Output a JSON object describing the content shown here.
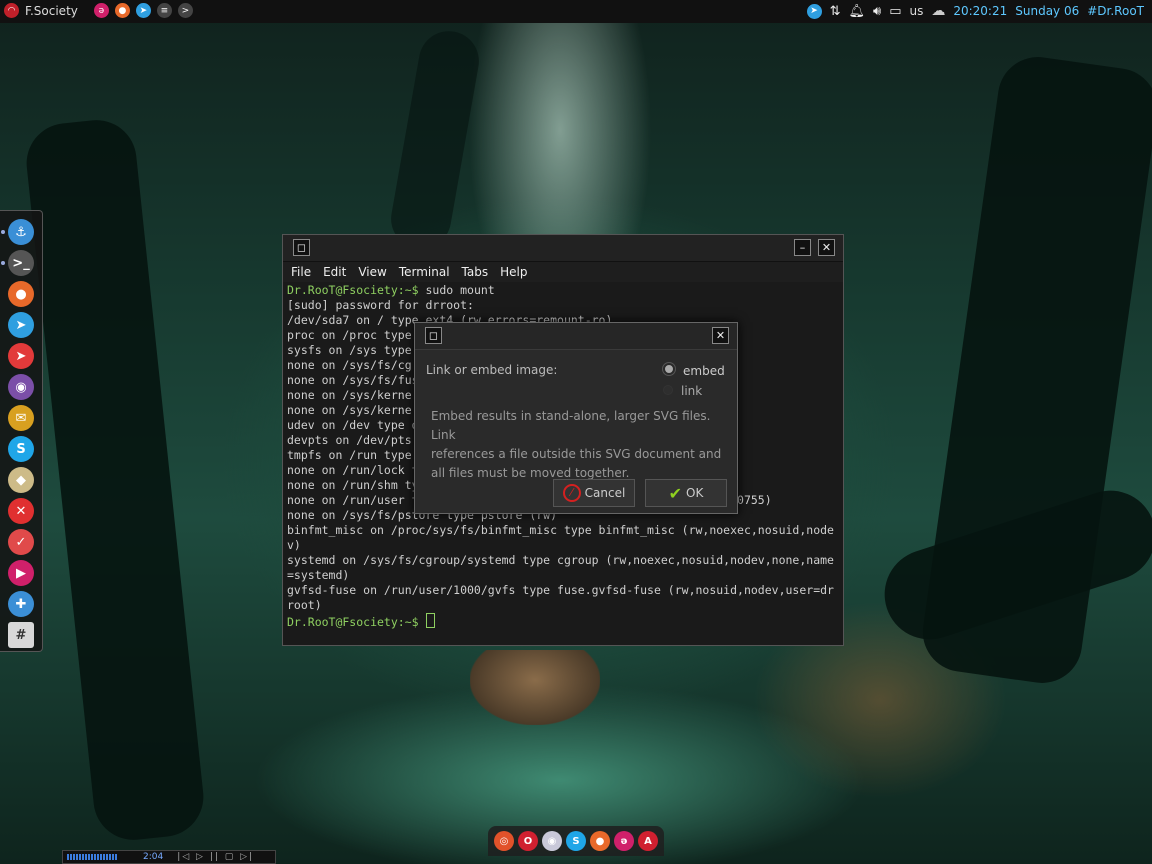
{
  "top_panel": {
    "brand": "F.Society",
    "left_icons": [
      "raspberry-icon",
      "firefox-icon",
      "telegram-icon",
      "menu-icon",
      "terminal-icon"
    ],
    "right_icons": [
      "telegram-icon",
      "network-icon",
      "notification-bell-icon",
      "volume-icon",
      "book-icon"
    ],
    "keyboard_layout": "us",
    "time": "20:20:21",
    "date": "Sunday 06",
    "user": "#Dr.RooT"
  },
  "left_dock": {
    "items": [
      {
        "name": "anchor-icon",
        "glyph": "⚓",
        "color": "#3a8fd6"
      },
      {
        "name": "terminal-icon",
        "glyph": ">_",
        "color": "#555555"
      },
      {
        "name": "firefox-icon",
        "glyph": "●",
        "color": "#e8692a"
      },
      {
        "name": "telegram-icon",
        "glyph": "➤",
        "color": "#2f9fe0"
      },
      {
        "name": "telegram-desktop-icon",
        "glyph": "➤",
        "color": "#e23a3a"
      },
      {
        "name": "chat-bird-icon",
        "glyph": "◉",
        "color": "#7b4fa8"
      },
      {
        "name": "mail-icon",
        "glyph": "✉",
        "color": "#d8a020"
      },
      {
        "name": "skype-icon",
        "glyph": "S",
        "color": "#1fa6e8"
      },
      {
        "name": "inkscape-icon",
        "glyph": "◆",
        "color": "#cdbb88"
      },
      {
        "name": "close-app-icon",
        "glyph": "✕",
        "color": "#e03030"
      },
      {
        "name": "tasks-icon",
        "glyph": "✓",
        "color": "#e04a4a"
      },
      {
        "name": "media-player-icon",
        "glyph": "▶",
        "color": "#d0206a"
      },
      {
        "name": "software-center-icon",
        "glyph": "✚",
        "color": "#3b8fd6"
      },
      {
        "name": "text-editor-icon",
        "glyph": "#",
        "color": "#d8d8d8"
      }
    ]
  },
  "terminal": {
    "menu": [
      "File",
      "Edit",
      "View",
      "Terminal",
      "Tabs",
      "Help"
    ],
    "prompt": "Dr.RooT@Fsociety:~$",
    "command": "sudo mount",
    "lines": [
      "[sudo] password for drroot:",
      "/dev/sda7 on / type ext4 (rw,errors=remount-ro)",
      "proc on /proc type",
      "sysfs on /sys type",
      "none on /sys/fs/cg",
      "none on /sys/fs/fus",
      "none on /sys/kerne",
      "none on /sys/kerne",
      "udev on /dev type d",
      "devpts on /dev/pts",
      "tmpfs on /run type",
      "none on /run/lock t",
      "none on /run/shm ty",
      "none on /run/user t                                     500,mode=0755)",
      "none on /sys/fs/pstore type pstore (rw)",
      "binfmt_misc on /proc/sys/fs/binfmt_misc type binfmt_misc (rw,noexec,nosuid,node",
      "v)",
      "systemd on /sys/fs/cgroup/systemd type cgroup (rw,noexec,nosuid,nodev,none,name",
      "=systemd)",
      "gvfsd-fuse on /run/user/1000/gvfs type fuse.gvfsd-fuse (rw,nosuid,nodev,user=dr",
      "root)"
    ]
  },
  "dialog": {
    "question": "Link or embed image:",
    "options": [
      {
        "label": "embed",
        "selected": true
      },
      {
        "label": "link",
        "selected": false
      }
    ],
    "description": [
      "Embed results in stand-alone, larger SVG files. Link",
      "references a file outside this SVG document and",
      "all files must be moved together."
    ],
    "cancel_label": "Cancel",
    "ok_label": "OK"
  },
  "bottom_dock": {
    "items": [
      {
        "name": "ubuntu-icon",
        "glyph": "◎",
        "color": "#e2522a"
      },
      {
        "name": "opera-icon",
        "glyph": "O",
        "color": "#d02030"
      },
      {
        "name": "webcam-icon",
        "glyph": "◉",
        "color": "#c9c9d9"
      },
      {
        "name": "skype-icon",
        "glyph": "S",
        "color": "#1fa6e8"
      },
      {
        "name": "firefox-icon",
        "glyph": "●",
        "color": "#e8692a"
      },
      {
        "name": "raspberry-icon",
        "glyph": "ə",
        "color": "#d0206a"
      },
      {
        "name": "app-store-icon",
        "glyph": "A",
        "color": "#d02030"
      }
    ]
  },
  "player": {
    "time": "2:04"
  }
}
